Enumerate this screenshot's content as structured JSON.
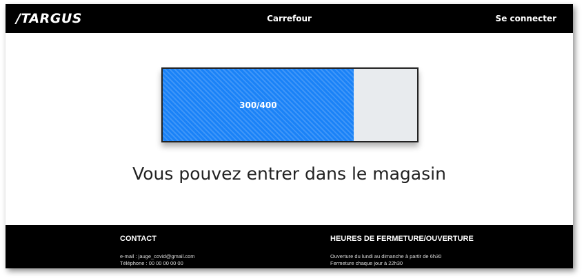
{
  "header": {
    "logo": "/TARGUS",
    "store_name": "Carrefour",
    "login_label": "Se connecter"
  },
  "gauge": {
    "current": 300,
    "max": 400,
    "label": "300/400",
    "fill_fraction": 0.75,
    "fill_color": "#1a82f7",
    "empty_color": "#e8ebee"
  },
  "status_message": "Vous pouvez entrer dans le magasin",
  "footer": {
    "contact": {
      "heading": "CONTACT",
      "email": "e-mail : jauge_covid@gmail.com",
      "phone": "Téléphone : 00 00 00 00 00"
    },
    "hours": {
      "heading": "HEURES DE FERMETURE/OUVERTURE",
      "opening": "Ouverture du lundi au dimanche à partir de 6h30",
      "closing": "Fermeture chaque jour à 22h30"
    }
  },
  "colors": {
    "header_bg": "#000000",
    "footer_bg": "#000000",
    "accent": "#1a82f7"
  }
}
